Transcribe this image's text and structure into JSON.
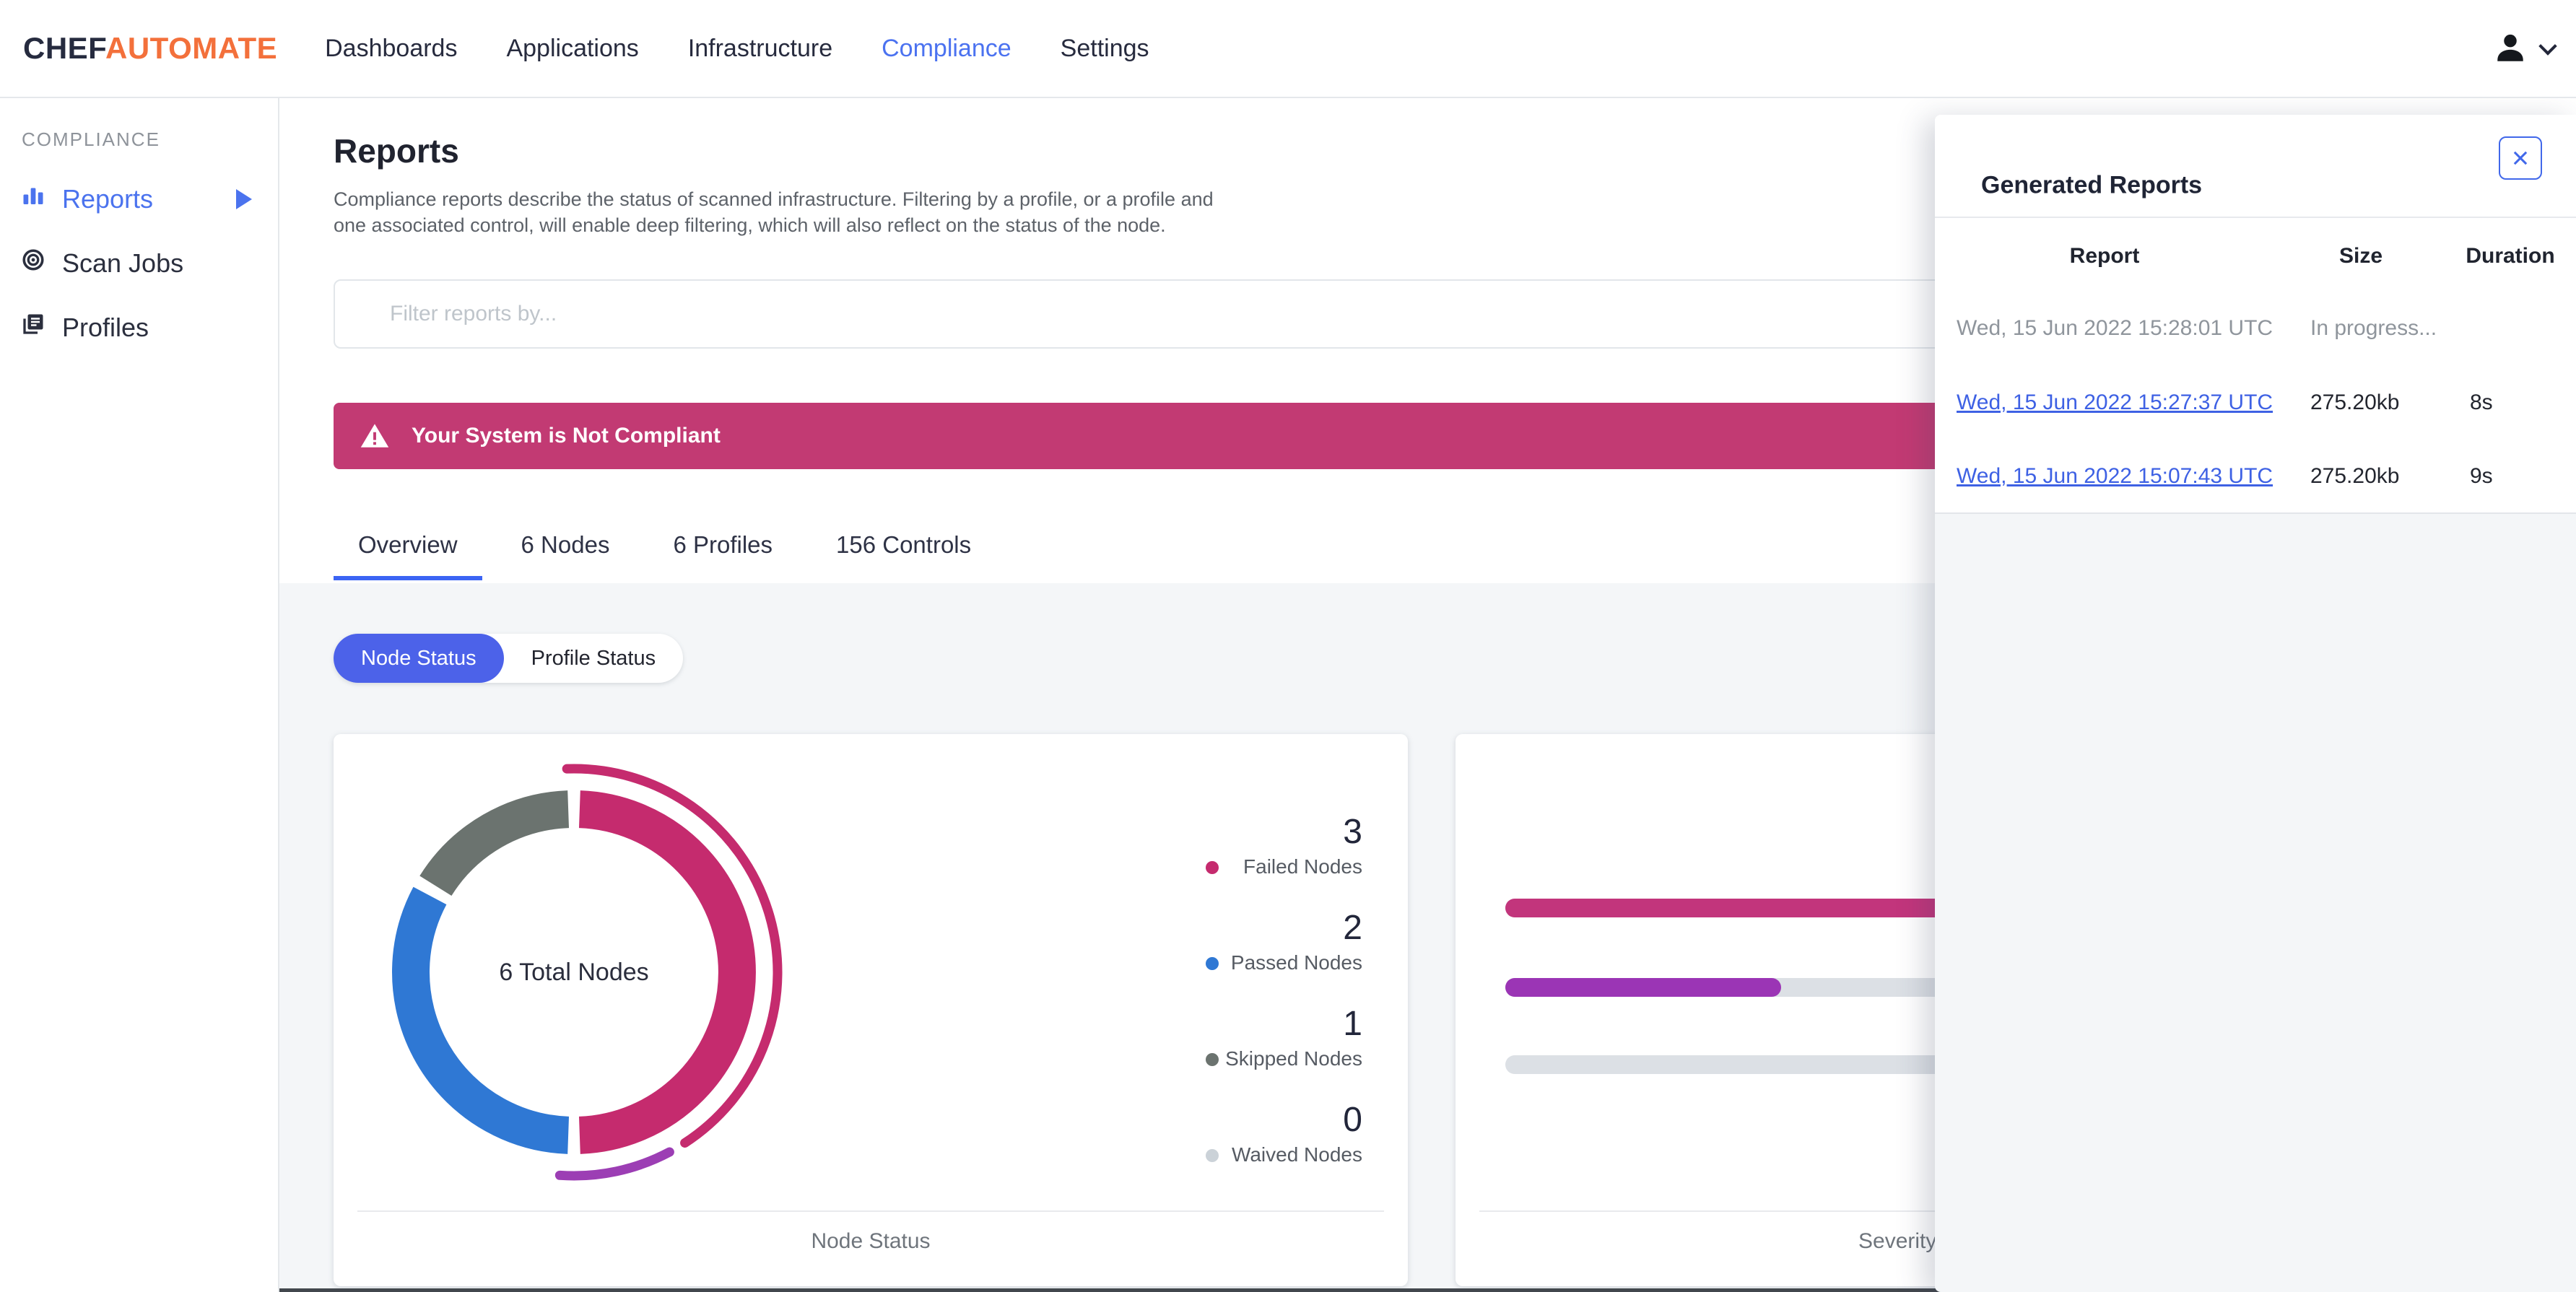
{
  "nav": {
    "brand": {
      "chef": "CHEF",
      "automate": "AUTOMATE"
    },
    "items": [
      {
        "label": "Dashboards",
        "active": false
      },
      {
        "label": "Applications",
        "active": false
      },
      {
        "label": "Infrastructure",
        "active": false
      },
      {
        "label": "Compliance",
        "active": true
      },
      {
        "label": "Settings",
        "active": false
      }
    ],
    "user_icons": [
      "person-icon",
      "chevron-down-icon"
    ]
  },
  "sidebar": {
    "section": "COMPLIANCE",
    "items": [
      {
        "label": "Reports",
        "active": true,
        "icon": "bar-chart-icon",
        "has_submenu_arrow": true
      },
      {
        "label": "Scan Jobs",
        "active": false,
        "icon": "scan-target-icon"
      },
      {
        "label": "Profiles",
        "active": false,
        "icon": "profiles-stack-icon"
      }
    ]
  },
  "page": {
    "title": "Reports",
    "description": "Compliance reports describe the status of scanned infrastructure. Filtering by a profile, or a profile and one associated control, will enable deep filtering, which will also reflect on the status of the node."
  },
  "filter": {
    "placeholder": "Filter reports by..."
  },
  "alert": {
    "message": "Your System is Not Compliant",
    "icon": "warning-triangle-icon",
    "color": "#C23A73"
  },
  "tabs": [
    {
      "label": "Overview",
      "active": true
    },
    {
      "label": "6 Nodes",
      "active": false
    },
    {
      "label": "6 Profiles",
      "active": false
    },
    {
      "label": "156 Controls",
      "active": false
    }
  ],
  "toggle": [
    {
      "label": "Node Status",
      "active": true
    },
    {
      "label": "Profile Status",
      "active": false
    }
  ],
  "cards": {
    "node_status": {
      "center_label": "6 Total Nodes",
      "footer": "Node Status",
      "legend": [
        {
          "value": "3",
          "label": "Failed Nodes",
          "color": "#C52B6E"
        },
        {
          "value": "2",
          "label": "Passed Nodes",
          "color": "#2F78D4"
        },
        {
          "value": "1",
          "label": "Skipped Nodes",
          "color": "#6B736F"
        },
        {
          "value": "0",
          "label": "Waived Nodes",
          "color": "#CBD2D8"
        }
      ]
    },
    "severity": {
      "footer": "Severity"
    }
  },
  "chart_data": [
    {
      "type": "pie",
      "variant": "donut",
      "title": "Node Status",
      "center_label": "6 Total Nodes",
      "total": 6,
      "slices": [
        {
          "label": "Failed Nodes",
          "value": 3,
          "color": "#C52B6E"
        },
        {
          "label": "Passed Nodes",
          "value": 2,
          "color": "#2F78D4"
        },
        {
          "label": "Skipped Nodes",
          "value": 1,
          "color": "#6B736F"
        },
        {
          "label": "Waived Nodes",
          "value": 0,
          "color": "#CBD2D8"
        }
      ],
      "outer_arcs": [
        {
          "color": "#C52B6E",
          "approx_span_deg": [
            -2,
            147
          ]
        },
        {
          "color": "#9C3EB4",
          "approx_span_deg": [
            152,
            184
          ]
        }
      ],
      "legend_position": "right"
    },
    {
      "type": "bar",
      "orientation": "horizontal",
      "title": "Severity",
      "note": "right portion hidden behind Generated Reports panel; values unlabeled",
      "series": [
        {
          "color": "#C2357C",
          "fill_percent_visible": 100
        },
        {
          "color": "#9B35B5",
          "fill_percent_visible": 64
        },
        {
          "color": "#DCE0E5",
          "fill_percent_visible": 0
        }
      ],
      "track_color": "#DCE0E5"
    }
  ],
  "panel": {
    "title": "Generated Reports",
    "close_icon": "close-x-icon",
    "columns": [
      "Report",
      "Size",
      "Duration"
    ],
    "rows": [
      {
        "report": "Wed, 15 Jun 2022 15:28:01 UTC",
        "size": "In progress...",
        "duration": "",
        "is_link": false
      },
      {
        "report": "Wed, 15 Jun 2022 15:27:37 UTC",
        "size": "275.20kb",
        "duration": "8s",
        "is_link": true
      },
      {
        "report": "Wed, 15 Jun 2022 15:07:43 UTC",
        "size": "275.20kb",
        "duration": "9s",
        "is_link": true
      }
    ]
  }
}
